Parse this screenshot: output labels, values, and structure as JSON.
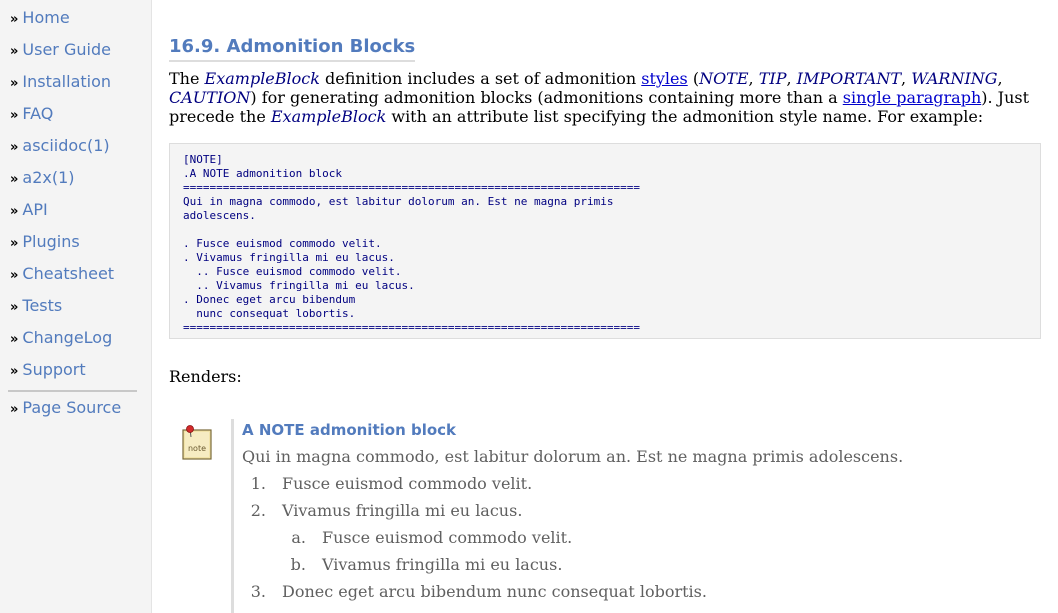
{
  "sidebar": {
    "bullet": "»",
    "items": [
      {
        "label": "Home"
      },
      {
        "label": "User Guide"
      },
      {
        "label": "Installation"
      },
      {
        "label": "FAQ"
      },
      {
        "label": "asciidoc(1)"
      },
      {
        "label": "a2x(1)"
      },
      {
        "label": "API"
      },
      {
        "label": "Plugins"
      },
      {
        "label": "Cheatsheet"
      },
      {
        "label": "Tests"
      },
      {
        "label": "ChangeLog"
      },
      {
        "label": "Support"
      },
      {
        "label": "Page Source"
      }
    ]
  },
  "main": {
    "heading": "16.9. Admonition Blocks",
    "intro": {
      "t1": "The ",
      "term1": "ExampleBlock",
      "t2": " definition includes a set of admonition ",
      "link_styles": "styles",
      "t3": " (",
      "s_note": "NOTE",
      "c1": ", ",
      "s_tip": "TIP",
      "c2": ", ",
      "s_important": "IMPORTANT",
      "c3": ", ",
      "s_warning": "WARNING",
      "c4": ", ",
      "s_caution": "CAUTION",
      "t4": ") for generating admonition blocks (admonitions containing more than a ",
      "link_single": "single paragraph",
      "t5": "). Just precede the ",
      "term2": "ExampleBlock",
      "t6": " with an attribute list specifying the admonition style name. For example:"
    },
    "listing_code": "[NOTE]\n.A NOTE admonition block\n=====================================================================\nQui in magna commodo, est labitur dolorum an. Est ne magna primis\nadolescens.\n\n. Fusce euismod commodo velit.\n. Vivamus fringilla mi eu lacus.\n  .. Fusce euismod commodo velit.\n  .. Vivamus fringilla mi eu lacus.\n. Donec eget arcu bibendum\n  nunc consequat lobortis.\n=====================================================================",
    "renders_label": "Renders:",
    "admonition": {
      "icon_text": "note",
      "title": "A NOTE admonition block",
      "paragraph": "Qui in magna commodo, est labitur dolorum an. Est ne magna primis adolescens.",
      "list": [
        {
          "marker": "1.",
          "text": "Fusce euismod commodo velit."
        },
        {
          "marker": "2.",
          "text": "Vivamus fringilla mi eu lacus."
        },
        {
          "marker": "a.",
          "text": "Fusce euismod commodo velit."
        },
        {
          "marker": "b.",
          "text": "Vivamus fringilla mi eu lacus."
        },
        {
          "marker": "3.",
          "text": "Donec eget arcu bibendum nunc consequat lobortis."
        }
      ]
    }
  },
  "colors": {
    "link_blue": "#527bbd",
    "term_navy": "#000080",
    "sidebar_bg": "#f4f4f4",
    "admon_text": "#606060"
  }
}
